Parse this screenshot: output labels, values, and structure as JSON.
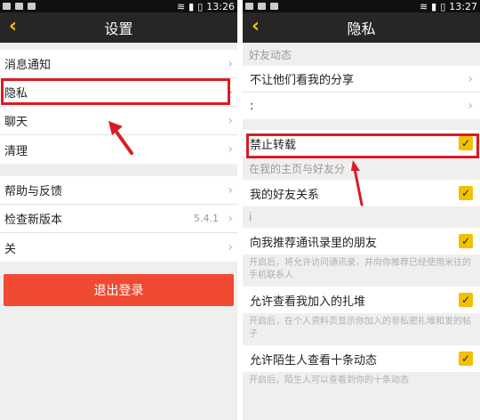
{
  "status": {
    "left_time": "13:26",
    "right_time": "13:27"
  },
  "left": {
    "title": "设置",
    "group1": [
      {
        "label": "消息通知"
      },
      {
        "label": "隐私"
      },
      {
        "label": "聊天"
      },
      {
        "label": "清理"
      }
    ],
    "group2": [
      {
        "label": "帮助与反馈",
        "value": ""
      },
      {
        "label": "检查新版本",
        "value": "5.4.1"
      },
      {
        "label": "关",
        "value": ""
      }
    ],
    "logout_label": "退出登录"
  },
  "right": {
    "title": "隐私",
    "sec1_header": "好友动态",
    "sec1_rows": [
      {
        "label": "不让他们看我的分享"
      },
      {
        "label": ":"
      }
    ],
    "forbid_label": "禁止转载",
    "sec2_header": "在我的主页与好友分",
    "friend_rel_label": "我的好友关系",
    "gap_mark": "i",
    "recommend_label": "向我推荐通讯录里的朋友",
    "recommend_desc": "开启后，将允许访问通讯录，并向你推荐已经使用米往的手机联系人",
    "joined_label": "允许查看我加入的扎堆",
    "joined_desc": "开启后，在个人资料页显示你加入的非私密扎堆和发的帖子",
    "stranger_label": "允许陌生人查看十条动态",
    "stranger_desc": "开启后，陌生人可以查看到你的十条动态"
  },
  "colors": {
    "accent": "#f2c000",
    "logout": "#f04a33",
    "highlight": "#d91c24"
  }
}
